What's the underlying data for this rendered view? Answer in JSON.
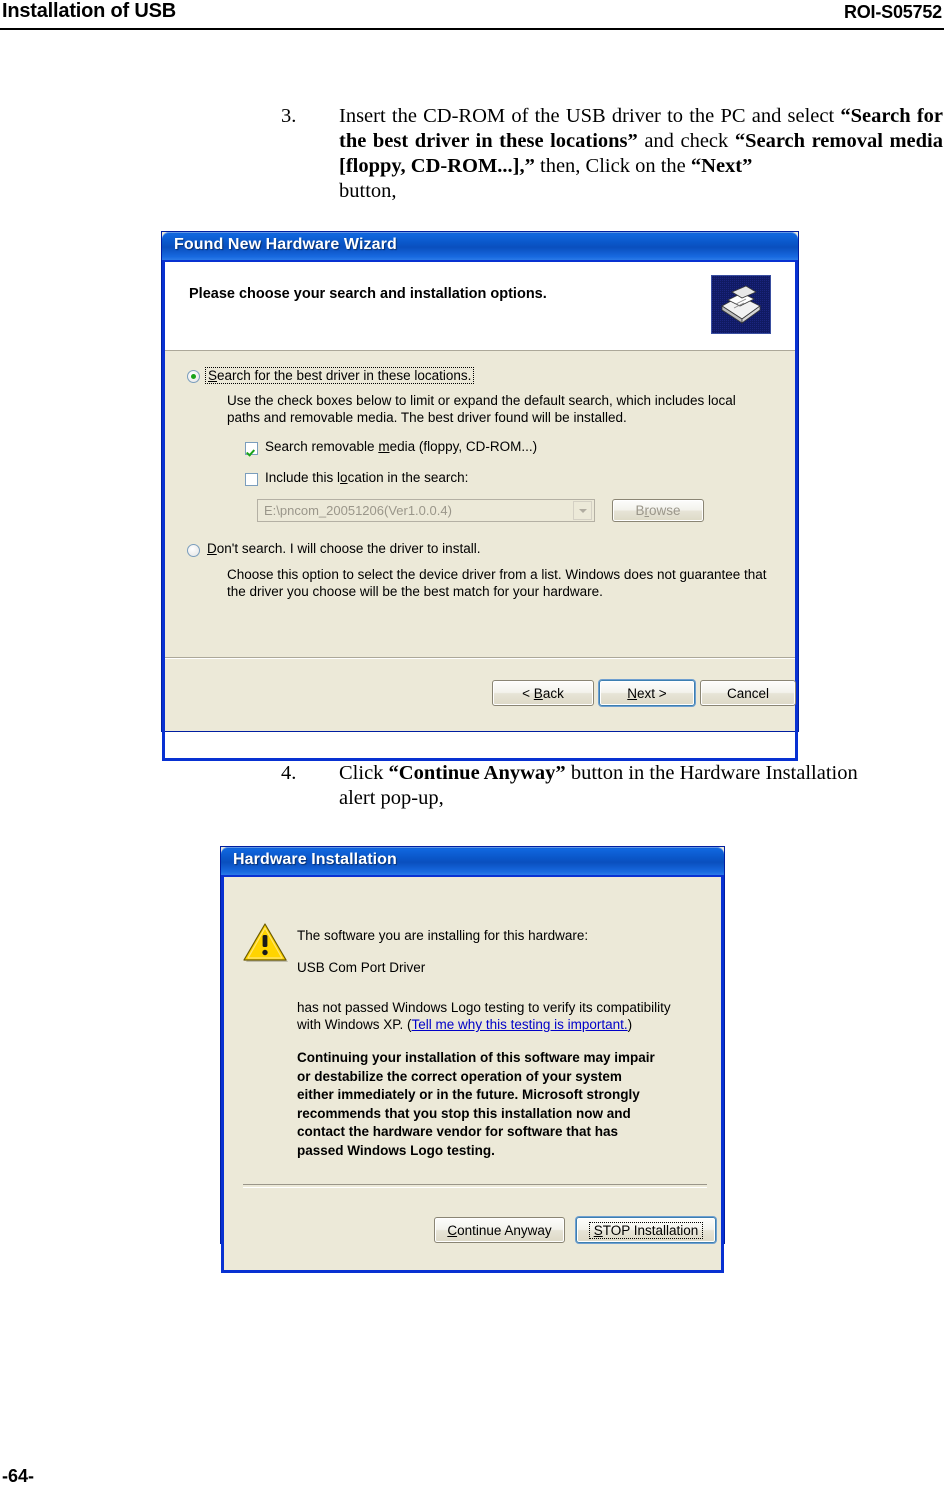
{
  "header": {
    "left_title": "Installation of USB",
    "right_code": "ROI-S05752"
  },
  "footer": {
    "page_number": "-64-"
  },
  "steps": [
    {
      "number": "3.",
      "line1": "Insert the CD-ROM of the USB driver to the PC and select",
      "q1": "“Search for the best driver in these locations”",
      "mid1": " and check ",
      "q2": "“Search removal media [floppy, CD-ROM...],”",
      "mid2": " then, Click on the ",
      "q3": "“Next”",
      "lastline": "button,"
    },
    {
      "number": "4.",
      "pre": "Click ",
      "q1": "“Continue Anyway”",
      "post": " button in the Hardware Installation",
      "lastline": "alert pop-up,"
    }
  ],
  "wizard_dialog": {
    "title": "Found New Hardware Wizard",
    "heading": "Please choose your search and installation options.",
    "icon_name": "wizard-drawer-icon",
    "option_search": {
      "label_accel": "S",
      "label_rest": "earch for the best driver in these locations.",
      "checked": true,
      "description_line1": "Use the check boxes below to limit or expand the default search, which includes local",
      "description_line2": "paths and removable media. The best driver found will be installed."
    },
    "checkbox_removable": {
      "pre": "Search removable ",
      "accel": "m",
      "post": "edia (floppy, CD-ROM...)",
      "checked": true
    },
    "checkbox_location": {
      "pre": "Include this l",
      "accel": "o",
      "post": "cation in the search:",
      "checked": false
    },
    "location_combo": {
      "value": "E:\\pncom_20051206(Ver1.0.0.4)",
      "disabled": true
    },
    "browse_button": {
      "pre": "B",
      "accel": "r",
      "post": "owse",
      "disabled": true
    },
    "option_dontsearch": {
      "label_accel": "D",
      "label_rest": "on't search. I will choose the driver to install.",
      "checked": false,
      "description_line1": "Choose this option to select the device driver from a list.  Windows does not guarantee that",
      "description_line2": "the driver you choose will be the best match for your hardware."
    },
    "buttons": {
      "back": {
        "pre": "< ",
        "accel": "B",
        "post": "ack"
      },
      "next": {
        "pre": "",
        "accel": "N",
        "post": "ext >",
        "is_default": true
      },
      "cancel": {
        "pre": "",
        "accel": "",
        "post": "Cancel"
      }
    }
  },
  "hardware_dialog": {
    "title": "Hardware Installation",
    "icon_name": "warning-triangle-icon",
    "line_intro": "The software you are installing for this hardware:",
    "device_name": "USB Com Port Driver",
    "notice_line1": "has not passed Windows Logo testing to verify its compatibility",
    "notice_line2_pre": "with Windows XP. (",
    "notice_link": "Tell me why this testing is important.",
    "notice_line2_post": ")",
    "warning_lines": [
      "Continuing your installation of this software may impair",
      "or destabilize the correct operation of your system",
      "either immediately or in the future. Microsoft strongly",
      "recommends that you stop this installation now and",
      "contact the hardware vendor for software that has",
      "passed Windows Logo testing."
    ],
    "buttons": {
      "continue": {
        "accel": "C",
        "post": "ontinue Anyway"
      },
      "stop": {
        "accel": "S",
        "post": "TOP Installation",
        "is_default": true
      }
    }
  },
  "colors": {
    "titlebar_blue": "#0a56c8",
    "dialog_face": "#ece9d8",
    "frame_blue": "#0831d2",
    "link_blue": "#0000c8",
    "check_green": "#19a319",
    "warning_yellow": "#ffd400"
  }
}
